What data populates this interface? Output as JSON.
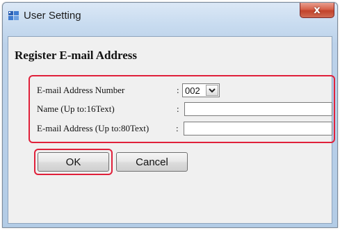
{
  "window": {
    "title": "User Setting",
    "close_glyph": "x"
  },
  "dialog": {
    "heading": "Register E-mail Address",
    "fields": {
      "address_number": {
        "label": "E-mail Address Number",
        "colon": ":",
        "value": "002"
      },
      "name": {
        "label": "Name (Up to:16Text)",
        "colon": ":",
        "value": ""
      },
      "email": {
        "label": "E-mail Address (Up to:80Text)",
        "colon": ":",
        "value": ""
      }
    },
    "buttons": {
      "ok": "OK",
      "cancel": "Cancel"
    }
  },
  "colors": {
    "highlight": "#e0203a",
    "close_button": "#c2432b",
    "titlebar": "#c9dcf0"
  },
  "icons": [
    "user-setting-app-icon",
    "close-icon",
    "chevron-down-icon"
  ]
}
